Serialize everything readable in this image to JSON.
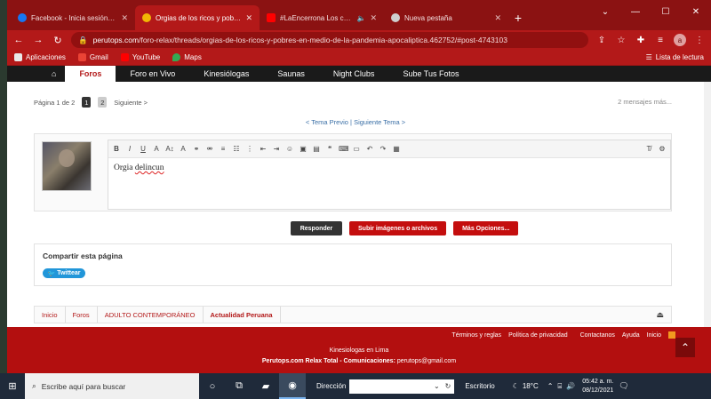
{
  "browser": {
    "tabs": [
      {
        "title": "Facebook - Inicia sesión o regístrate",
        "fav_color": "#1877f2",
        "active": false,
        "sound": false
      },
      {
        "title": "Orgias de los ricos y pobres en medio de la pandemia",
        "fav_color": "#f2b705",
        "active": true,
        "sound": false
      },
      {
        "title": "#LaEncerrona Los conciertos",
        "fav_color": "#ff0000",
        "active": false,
        "sound": true
      },
      {
        "title": "Nueva pestaña",
        "fav_color": "#cfcfcf",
        "active": false,
        "sound": false
      }
    ],
    "url_host": "perutops.com",
    "url_path": "/foro-relax/threads/orgias-de-los-ricos-y-pobres-en-medio-de-la-pandemia-apocaliptica.462752/#post-4743103",
    "bookmarks": [
      {
        "label": "Aplicaciones",
        "color": "#e9e9e9"
      },
      {
        "label": "Gmail",
        "color": "#ea4335"
      },
      {
        "label": "YouTube",
        "color": "#ff0000"
      },
      {
        "label": "Maps",
        "color": "#34a853"
      }
    ],
    "reading_list": "Lista de lectura"
  },
  "nav": {
    "items": [
      "Foros",
      "Foro en Vivo",
      "Kinesiólogas",
      "Saunas",
      "Night Clubs",
      "Sube Tus Fotos"
    ],
    "active": "Foros"
  },
  "thread": {
    "page_label": "Página 1 de 2",
    "pages": [
      "1",
      "2"
    ],
    "next_label": "Siguiente >",
    "message_count": "2 mensajes más...",
    "prev_thread": "< Tema Previo",
    "separator": "|",
    "next_thread": "Siguiente Tema >"
  },
  "editor": {
    "text_plain": "Orgia ",
    "text_misspelled": "delincun"
  },
  "actions": {
    "reply": "Responder",
    "upload": "Subir imágenes o archivos",
    "more": "Más Opciones..."
  },
  "share": {
    "title": "Compartir esta página",
    "twitter": "Twittear"
  },
  "breadcrumb": [
    "Inicio",
    "Foros",
    "ADULTO CONTEMPORÁNEO",
    "Actualidad Peruana"
  ],
  "footer": {
    "links": [
      "Términos y reglas",
      "Política de privacidad",
      "Contactanos",
      "Ayuda",
      "Inicio"
    ],
    "title": "Kinesiologas en Lima",
    "comm_label": "Perutops.com Relax Total - Comunicaciones:",
    "email": "perutops@gmail.com"
  },
  "taskbar": {
    "search_placeholder": "Escribe aquí para buscar",
    "address_label": "Dirección",
    "desktop_label": "Escritorio",
    "temperature": "18°C",
    "time": "05:42 a. m.",
    "date": "08/12/2021"
  }
}
